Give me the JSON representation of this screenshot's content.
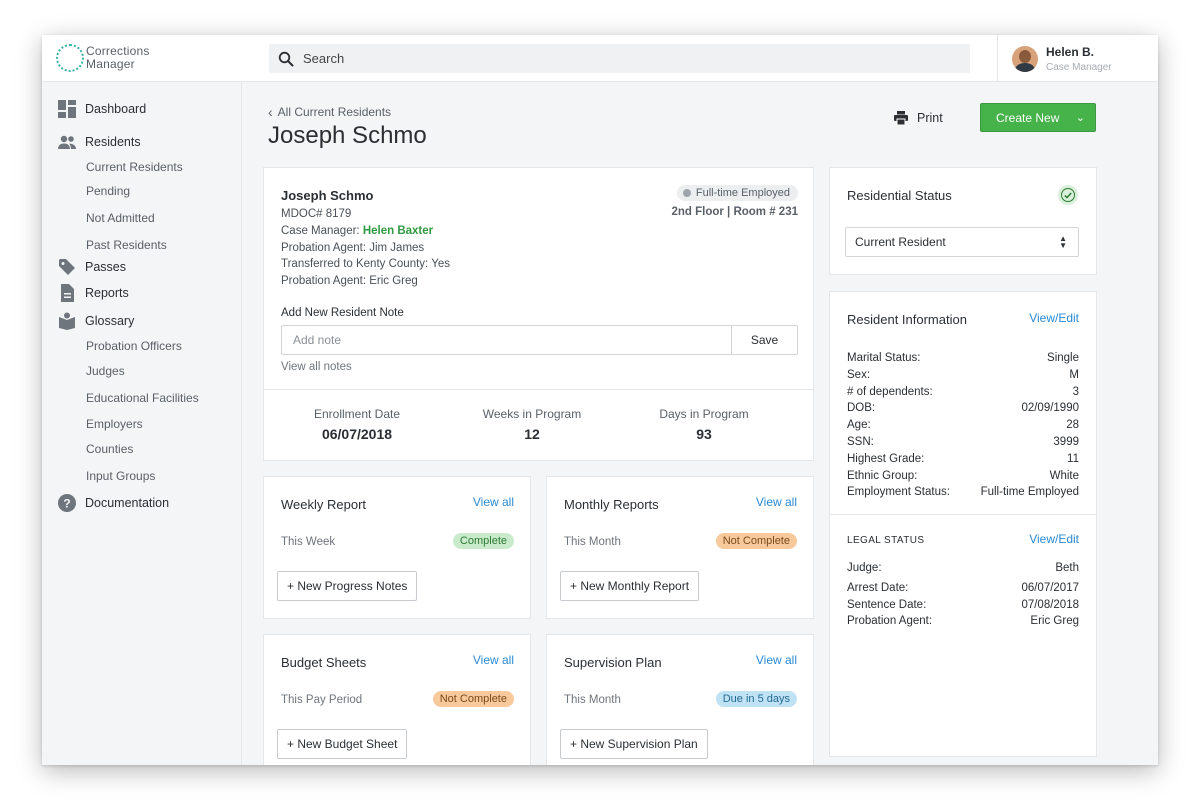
{
  "app": {
    "logo_line1": "Corrections",
    "logo_line2": "Manager",
    "brand_color": "#34b3a6"
  },
  "search": {
    "placeholder": "Search"
  },
  "user": {
    "name": "Helen B.",
    "role": "Case Manager"
  },
  "sidebar": {
    "items": [
      {
        "label": "Dashboard",
        "icon": "dashboard-icon"
      },
      {
        "label": "Residents",
        "icon": "people-icon"
      },
      {
        "label": "Passes",
        "icon": "tag-icon"
      },
      {
        "label": "Reports",
        "icon": "document-icon"
      },
      {
        "label": "Glossary",
        "icon": "book-icon"
      },
      {
        "label": "Documentation",
        "icon": "help-icon"
      }
    ],
    "residents_sub": [
      "Current Residents",
      "Pending",
      "Not Admitted",
      "Past Residents"
    ],
    "glossary_sub": [
      "Probation Officers",
      "Judges",
      "Educational Facilities",
      "Employers",
      "Counties",
      "Input Groups"
    ]
  },
  "header": {
    "back_label": "All Current Residents",
    "title": "Joseph Schmo",
    "print_label": "Print",
    "create_label": "Create New"
  },
  "resident": {
    "name": "Joseph Schmo",
    "mdoc": "MDOC# 8179",
    "case_manager_label": "Case Manager:",
    "case_manager": "Helen Baxter",
    "probation_agent": "Probation Agent: Jim James",
    "transferred": "Transferred to Kenty County: Yes",
    "probation_agent2": "Probation Agent: Eric Greg",
    "employment_badge": "Full-time Employed",
    "room": "2nd Floor | Room # 231"
  },
  "notes": {
    "label": "Add New Resident Note",
    "placeholder": "Add note",
    "save_label": "Save",
    "view_all": "View all notes"
  },
  "stats": [
    {
      "label": "Enrollment Date",
      "value": "06/07/2018"
    },
    {
      "label": "Weeks in Program",
      "value": "12"
    },
    {
      "label": "Days in Program",
      "value": "93"
    }
  ],
  "reports": [
    {
      "title": "Weekly Report",
      "link": "View all",
      "period": "This Week",
      "badge": "Complete",
      "button": "+ New Progress Notes"
    },
    {
      "title": "Monthly Reports",
      "link": "View all",
      "period": "This Month",
      "badge": "Not Complete",
      "button": "+ New Monthly Report"
    },
    {
      "title": "Budget Sheets",
      "link": "View all",
      "period": "This Pay Period",
      "badge": "Not Complete",
      "button": "+ New Budget Sheet"
    },
    {
      "title": "Supervision Plan",
      "link": "View all",
      "period": "This Month",
      "badge": "Due in 5 days",
      "button": "+ New Supervision Plan"
    }
  ],
  "residential_status": {
    "title": "Residential Status",
    "selected": "Current Resident"
  },
  "resident_info": {
    "title": "Resident Information",
    "link": "View/Edit",
    "rows": [
      {
        "k": "Marital Status:",
        "v": "Single"
      },
      {
        "k": "Sex:",
        "v": "M"
      },
      {
        "k": "# of dependents:",
        "v": "3"
      },
      {
        "k": "DOB:",
        "v": "02/09/1990"
      },
      {
        "k": "Age:",
        "v": "28"
      },
      {
        "k": "SSN:",
        "v": "3999"
      },
      {
        "k": "Highest Grade:",
        "v": "11"
      },
      {
        "k": "Ethnic Group:",
        "v": "White"
      },
      {
        "k": "Employment Status:",
        "v": "Full-time Employed"
      }
    ]
  },
  "legal": {
    "title": "LEGAL STATUS",
    "link": "View/Edit",
    "rows": [
      {
        "k": "Judge:",
        "v": "Beth"
      },
      {
        "k": "Arrest Date:",
        "v": "06/07/2017"
      },
      {
        "k": "Sentence Date:",
        "v": "07/08/2018"
      },
      {
        "k": "Probation Agent:",
        "v": "Eric Greg"
      }
    ]
  }
}
